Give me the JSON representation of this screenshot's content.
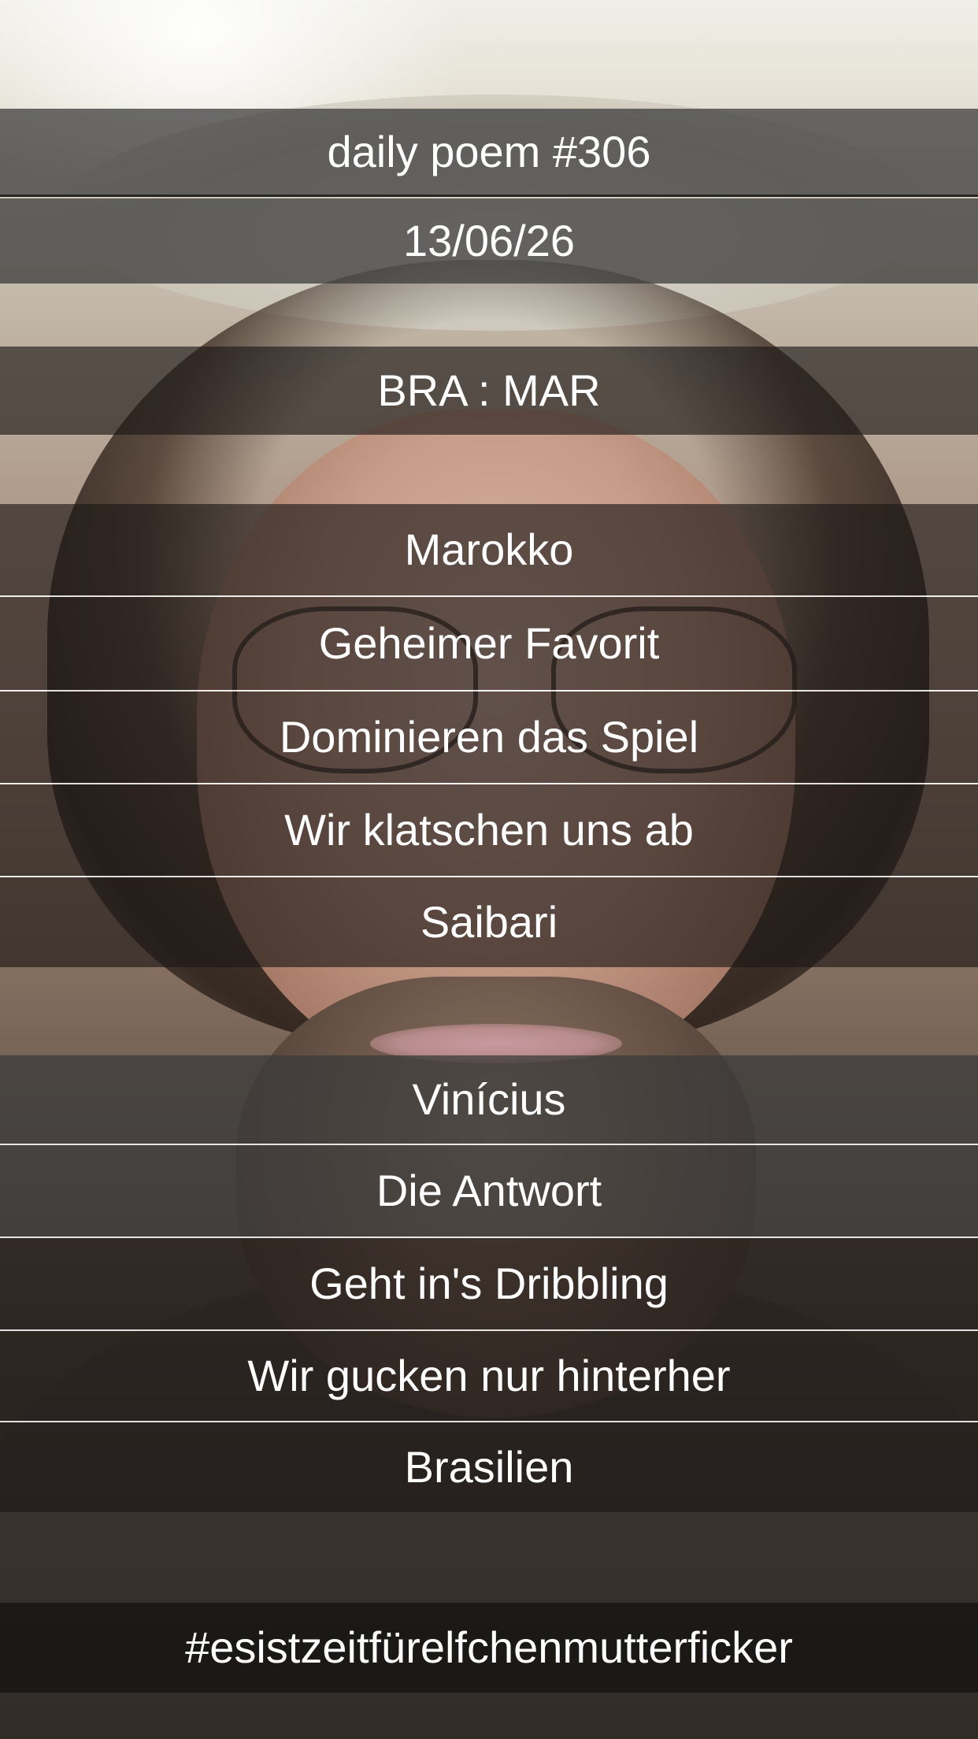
{
  "poem": {
    "title": "daily poem #306",
    "date": "13/06/26",
    "match": "BRA : MAR",
    "stanza_one": [
      "Marokko",
      "Geheimer Favorit",
      "Dominieren das Spiel",
      "Wir klatschen uns ab",
      "Saibari"
    ],
    "stanza_two": [
      "Vinícius",
      "Die Antwort",
      "Geht in's Dribbling",
      "Wir gucken nur hinterher",
      "Brasilien"
    ],
    "hashtag": "#esistzeitfürelfchenmutterficker"
  }
}
